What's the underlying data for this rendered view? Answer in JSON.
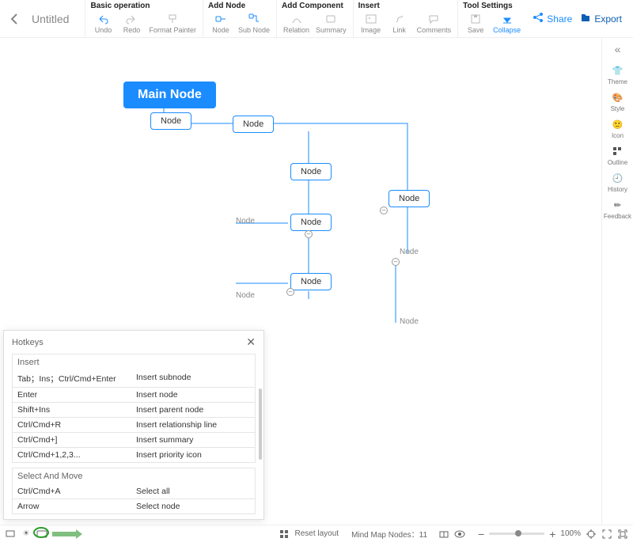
{
  "doc": {
    "title": "Untitled"
  },
  "toolbar": {
    "groups": {
      "basic": {
        "title": "Basic operation",
        "undo": "Undo",
        "redo": "Redo",
        "format_painter": "Format Painter"
      },
      "add_node": {
        "title": "Add Node",
        "node": "Node",
        "sub_node": "Sub Node"
      },
      "add_comp": {
        "title": "Add Component",
        "relation": "Relation",
        "summary": "Summary"
      },
      "insert": {
        "title": "Insert",
        "image": "Image",
        "link": "Link",
        "comments": "Comments"
      },
      "tool": {
        "title": "Tool Settings",
        "save": "Save",
        "collapse": "Collapse"
      }
    },
    "share": "Share",
    "export": "Export"
  },
  "rightpanel": {
    "theme": "Theme",
    "style": "Style",
    "icon": "Icon",
    "outline": "Outline",
    "history": "History",
    "feedback": "Feedback"
  },
  "nodes": {
    "main": "Main Node",
    "n1": "Node",
    "n2": "Node",
    "n3": "Node",
    "n4": "Node",
    "n5": "Node",
    "n6": "Node",
    "t1": "Node",
    "t2": "Node",
    "t3": "Node",
    "t4": "Node"
  },
  "hotkeys": {
    "title": "Hotkeys",
    "sections": {
      "insert": "Insert",
      "select_move": "Select And Move"
    },
    "rows": [
      {
        "k": "Tab；Ins；Ctrl/Cmd+Enter",
        "d": "Insert subnode"
      },
      {
        "k": "Enter",
        "d": "Insert node"
      },
      {
        "k": "Shift+Ins",
        "d": "Insert parent node"
      },
      {
        "k": "Ctrl/Cmd+R",
        "d": "Insert relationship line"
      },
      {
        "k": "Ctrl/Cmd+]",
        "d": "Insert summary"
      },
      {
        "k": "Ctrl/Cmd+1,2,3...",
        "d": "Insert priority icon"
      }
    ],
    "rows2": [
      {
        "k": "Ctrl/Cmd+A",
        "d": "Select all"
      },
      {
        "k": "Arrow",
        "d": "Select node"
      }
    ]
  },
  "bottom": {
    "reset_layout": "Reset layout",
    "nodes_label": "Mind Map Nodes：",
    "nodes_count": "11",
    "zoom": "100%"
  }
}
